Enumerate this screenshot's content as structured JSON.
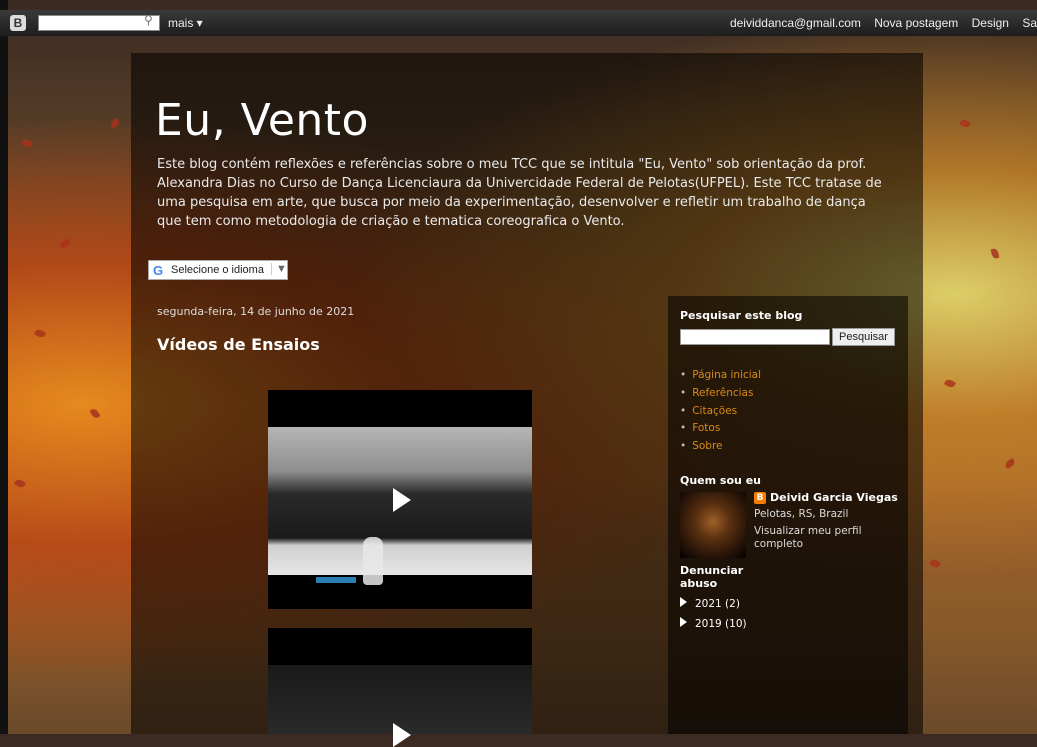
{
  "navbar": {
    "logo_letter": "B",
    "more_label": "mais ▾",
    "email": "deividdanca@gmail.com",
    "new_post": "Nova postagem",
    "design": "Design",
    "signout_partial": "Sa"
  },
  "blog": {
    "title": "Eu, Vento",
    "description": "Este blog contém reflexões e referências sobre o meu TCC que se intitula \"Eu, Vento\" sob orientação da prof. Alexandra Dias no Curso de Dança Licenciaura da Univercidade Federal de Pelotas(UFPEL). Este TCC tratase de uma pesquisa em arte, que busca por meio da experimentação, desenvolver e refletir um trabalho de dança que tem como metodologia de criação e tematica coreografica o Vento."
  },
  "translate": {
    "label": "Selecione o idioma",
    "arrow": "▼"
  },
  "post": {
    "date": "segunda-feira, 14 de junho de 2021",
    "title": "Vídeos de Ensaios"
  },
  "sidebar": {
    "search_heading": "Pesquisar este blog",
    "search_button": "Pesquisar",
    "pages": [
      "Página inicial",
      "Referências",
      "Citações",
      "Fotos",
      "Sobre"
    ],
    "about_heading": "Quem sou eu",
    "profile_name": "Deivid Garcia Viegas",
    "profile_location": "Pelotas, RS, Brazil",
    "profile_link": "Visualizar meu perfil completo",
    "report_abuse": "Denunciar abuso",
    "archive": [
      {
        "label": "2021 (2)"
      },
      {
        "label": "2019 (10)"
      }
    ]
  },
  "colors": {
    "link": "#d98a1a",
    "panel": "rgba(0,0,0,0.55)"
  }
}
